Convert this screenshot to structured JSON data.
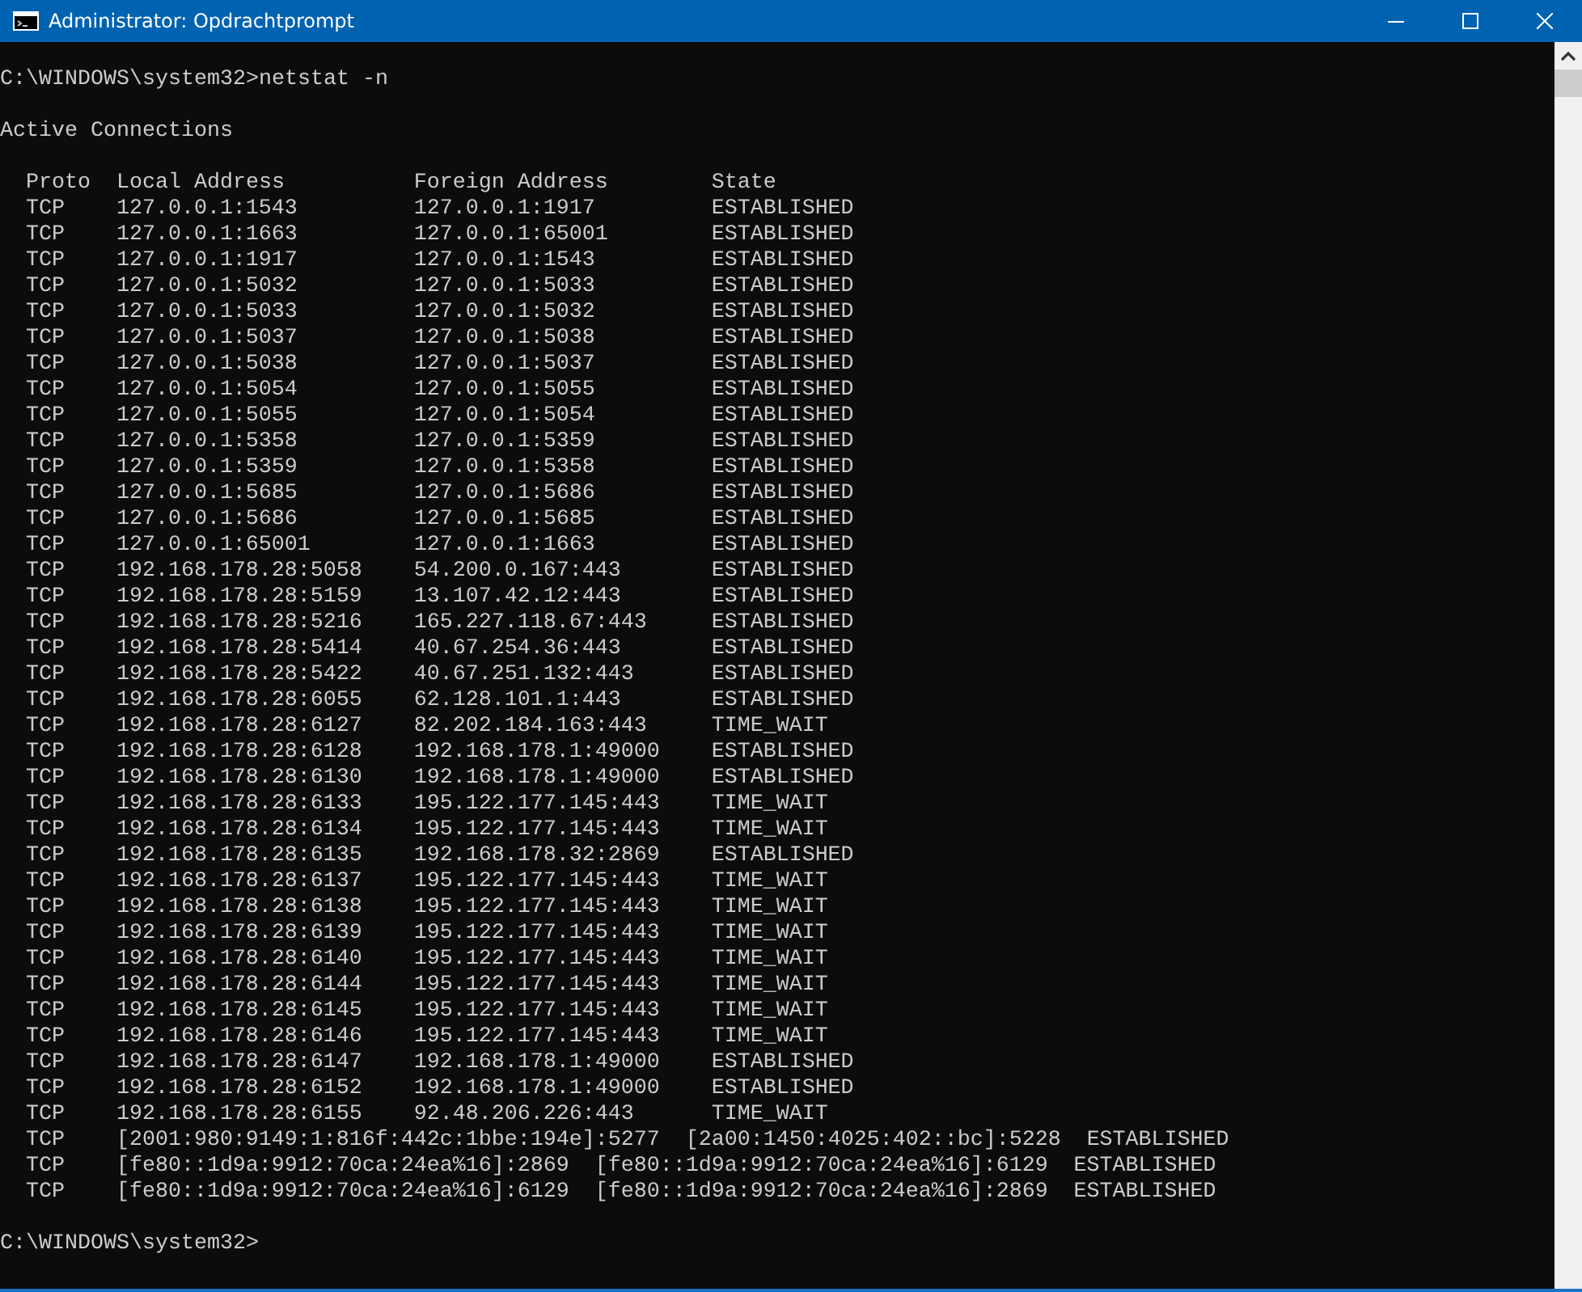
{
  "window": {
    "title": "Administrator: Opdrachtprompt"
  },
  "console": {
    "command_line": "C:\\WINDOWS\\system32>netstat -n",
    "heading": "Active Connections",
    "table": {
      "columns": [
        "Proto",
        "Local Address",
        "Foreign Address",
        "State"
      ],
      "rows": [
        [
          "TCP",
          "127.0.0.1:1543",
          "127.0.0.1:1917",
          "ESTABLISHED"
        ],
        [
          "TCP",
          "127.0.0.1:1663",
          "127.0.0.1:65001",
          "ESTABLISHED"
        ],
        [
          "TCP",
          "127.0.0.1:1917",
          "127.0.0.1:1543",
          "ESTABLISHED"
        ],
        [
          "TCP",
          "127.0.0.1:5032",
          "127.0.0.1:5033",
          "ESTABLISHED"
        ],
        [
          "TCP",
          "127.0.0.1:5033",
          "127.0.0.1:5032",
          "ESTABLISHED"
        ],
        [
          "TCP",
          "127.0.0.1:5037",
          "127.0.0.1:5038",
          "ESTABLISHED"
        ],
        [
          "TCP",
          "127.0.0.1:5038",
          "127.0.0.1:5037",
          "ESTABLISHED"
        ],
        [
          "TCP",
          "127.0.0.1:5054",
          "127.0.0.1:5055",
          "ESTABLISHED"
        ],
        [
          "TCP",
          "127.0.0.1:5055",
          "127.0.0.1:5054",
          "ESTABLISHED"
        ],
        [
          "TCP",
          "127.0.0.1:5358",
          "127.0.0.1:5359",
          "ESTABLISHED"
        ],
        [
          "TCP",
          "127.0.0.1:5359",
          "127.0.0.1:5358",
          "ESTABLISHED"
        ],
        [
          "TCP",
          "127.0.0.1:5685",
          "127.0.0.1:5686",
          "ESTABLISHED"
        ],
        [
          "TCP",
          "127.0.0.1:5686",
          "127.0.0.1:5685",
          "ESTABLISHED"
        ],
        [
          "TCP",
          "127.0.0.1:65001",
          "127.0.0.1:1663",
          "ESTABLISHED"
        ],
        [
          "TCP",
          "192.168.178.28:5058",
          "54.200.0.167:443",
          "ESTABLISHED"
        ],
        [
          "TCP",
          "192.168.178.28:5159",
          "13.107.42.12:443",
          "ESTABLISHED"
        ],
        [
          "TCP",
          "192.168.178.28:5216",
          "165.227.118.67:443",
          "ESTABLISHED"
        ],
        [
          "TCP",
          "192.168.178.28:5414",
          "40.67.254.36:443",
          "ESTABLISHED"
        ],
        [
          "TCP",
          "192.168.178.28:5422",
          "40.67.251.132:443",
          "ESTABLISHED"
        ],
        [
          "TCP",
          "192.168.178.28:6055",
          "62.128.101.1:443",
          "ESTABLISHED"
        ],
        [
          "TCP",
          "192.168.178.28:6127",
          "82.202.184.163:443",
          "TIME_WAIT"
        ],
        [
          "TCP",
          "192.168.178.28:6128",
          "192.168.178.1:49000",
          "ESTABLISHED"
        ],
        [
          "TCP",
          "192.168.178.28:6130",
          "192.168.178.1:49000",
          "ESTABLISHED"
        ],
        [
          "TCP",
          "192.168.178.28:6133",
          "195.122.177.145:443",
          "TIME_WAIT"
        ],
        [
          "TCP",
          "192.168.178.28:6134",
          "195.122.177.145:443",
          "TIME_WAIT"
        ],
        [
          "TCP",
          "192.168.178.28:6135",
          "192.168.178.32:2869",
          "ESTABLISHED"
        ],
        [
          "TCP",
          "192.168.178.28:6137",
          "195.122.177.145:443",
          "TIME_WAIT"
        ],
        [
          "TCP",
          "192.168.178.28:6138",
          "195.122.177.145:443",
          "TIME_WAIT"
        ],
        [
          "TCP",
          "192.168.178.28:6139",
          "195.122.177.145:443",
          "TIME_WAIT"
        ],
        [
          "TCP",
          "192.168.178.28:6140",
          "195.122.177.145:443",
          "TIME_WAIT"
        ],
        [
          "TCP",
          "192.168.178.28:6144",
          "195.122.177.145:443",
          "TIME_WAIT"
        ],
        [
          "TCP",
          "192.168.178.28:6145",
          "195.122.177.145:443",
          "TIME_WAIT"
        ],
        [
          "TCP",
          "192.168.178.28:6146",
          "195.122.177.145:443",
          "TIME_WAIT"
        ],
        [
          "TCP",
          "192.168.178.28:6147",
          "192.168.178.1:49000",
          "ESTABLISHED"
        ],
        [
          "TCP",
          "192.168.178.28:6152",
          "192.168.178.1:49000",
          "ESTABLISHED"
        ],
        [
          "TCP",
          "192.168.178.28:6155",
          "92.48.206.226:443",
          "TIME_WAIT"
        ],
        [
          "TCP",
          "[2001:980:9149:1:816f:442c:1bbe:194e]:5277",
          "[2a00:1450:4025:402::bc]:5228",
          "ESTABLISHED"
        ],
        [
          "TCP",
          "[fe80::1d9a:9912:70ca:24ea%16]:2869",
          "[fe80::1d9a:9912:70ca:24ea%16]:6129",
          "ESTABLISHED"
        ],
        [
          "TCP",
          "[fe80::1d9a:9912:70ca:24ea%16]:6129",
          "[fe80::1d9a:9912:70ca:24ea%16]:2869",
          "ESTABLISHED"
        ]
      ]
    },
    "prompt": "C:\\WINDOWS\\system32>"
  }
}
